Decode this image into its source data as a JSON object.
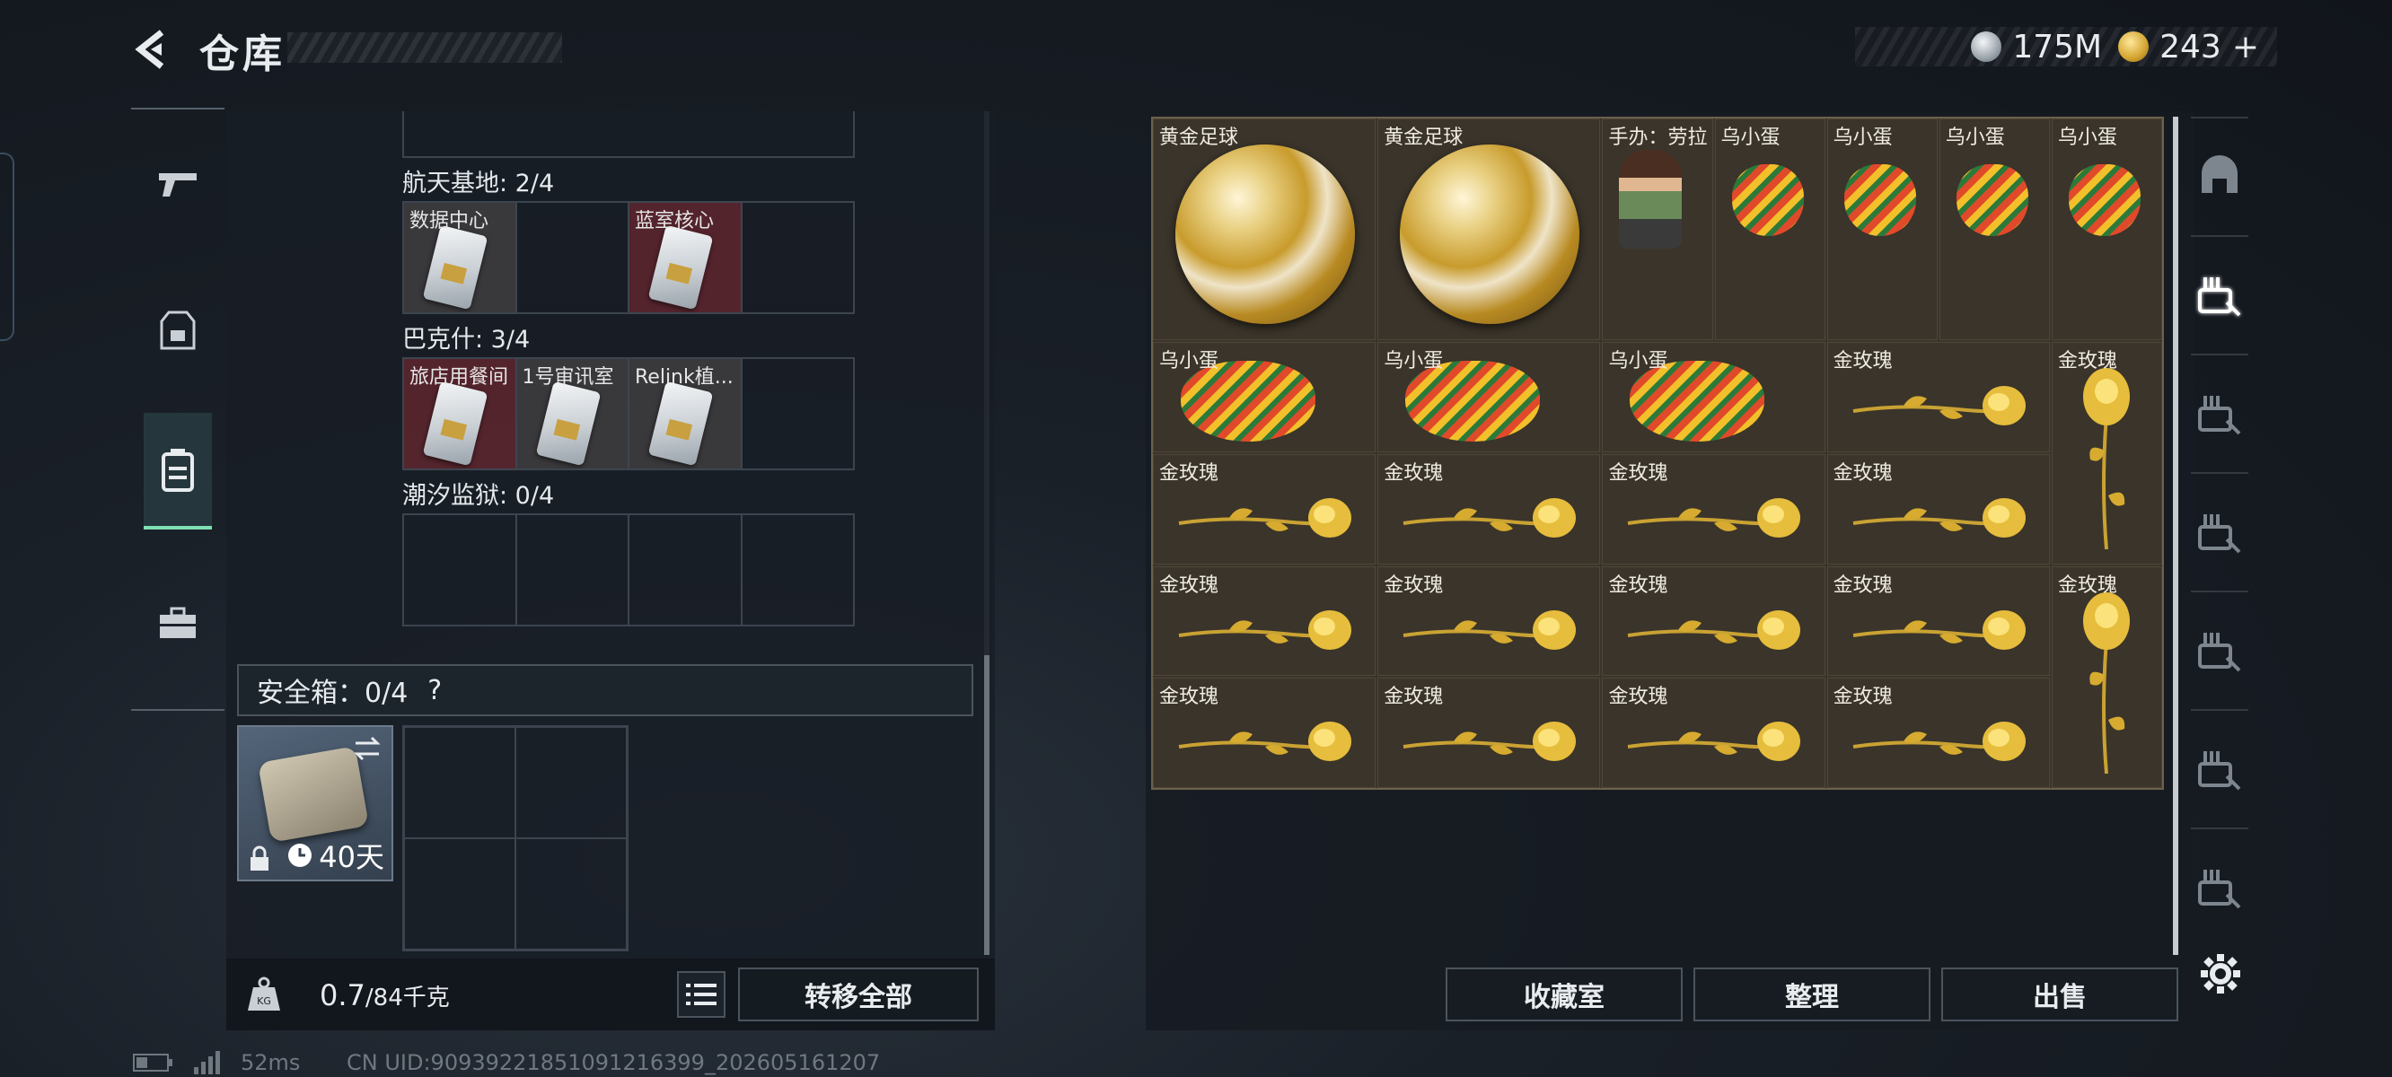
{
  "header": {
    "title": "仓库",
    "currency": [
      {
        "icon": "silver-coin-icon",
        "value": "175M"
      },
      {
        "icon": "gold-coin-icon",
        "value": "243"
      }
    ],
    "currency_add": "+"
  },
  "nav": [
    {
      "icon": "gun-icon",
      "active": false
    },
    {
      "icon": "vest-icon",
      "active": false
    },
    {
      "icon": "backpack-icon",
      "active": true
    },
    {
      "icon": "case-icon",
      "active": false
    }
  ],
  "keycard_sections": [
    {
      "label": "航天基地: 2/4",
      "slots": [
        {
          "name": "数据中心",
          "rarity": "gray",
          "filled": true
        },
        {
          "name": "",
          "filled": false
        },
        {
          "name": "蓝室核心",
          "rarity": "red",
          "filled": true
        },
        {
          "name": "",
          "filled": false
        }
      ]
    },
    {
      "label": "巴克什: 3/4",
      "slots": [
        {
          "name": "旅店用餐间",
          "rarity": "red",
          "filled": true
        },
        {
          "name": "1号审讯室",
          "rarity": "gray",
          "filled": true
        },
        {
          "name": "Relink植...",
          "rarity": "gray",
          "filled": true
        },
        {
          "name": "",
          "filled": false
        }
      ]
    },
    {
      "label": "潮汐监狱: 0/4",
      "slots": [
        {
          "name": "",
          "filled": false
        },
        {
          "name": "",
          "filled": false
        },
        {
          "name": "",
          "filled": false
        },
        {
          "name": "",
          "filled": false
        }
      ]
    }
  ],
  "safe_box": {
    "label": "安全箱：0/4",
    "help": "?",
    "days": "40天"
  },
  "weight": {
    "current": "0.7",
    "max": "/84千克"
  },
  "buttons": {
    "transfer_all": "转移全部",
    "collection": "收藏室",
    "sort": "整理",
    "sell": "出售"
  },
  "status": {
    "ping": "52ms",
    "uid": "CN UID:909392218510912163​99_202605161207"
  },
  "inventory": [
    {
      "name": "黄金足球",
      "type": "ball",
      "col": 1,
      "row": 1,
      "w": 2,
      "h": 2
    },
    {
      "name": "黄金足球",
      "type": "ball",
      "col": 3,
      "row": 1,
      "w": 2,
      "h": 2
    },
    {
      "name": "手办：劳拉",
      "type": "figure",
      "col": 5,
      "row": 1,
      "w": 1,
      "h": 2
    },
    {
      "name": "乌小蛋",
      "type": "egg",
      "col": 6,
      "row": 1,
      "w": 1,
      "h": 2
    },
    {
      "name": "乌小蛋",
      "type": "egg",
      "col": 7,
      "row": 1,
      "w": 1,
      "h": 2
    },
    {
      "name": "乌小蛋",
      "type": "egg",
      "col": 8,
      "row": 1,
      "w": 1,
      "h": 2
    },
    {
      "name": "乌小蛋",
      "type": "egg",
      "col": 9,
      "row": 1,
      "w": 1,
      "h": 2
    },
    {
      "name": "乌小蛋",
      "type": "egg-h",
      "col": 1,
      "row": 3,
      "w": 2,
      "h": 1
    },
    {
      "name": "乌小蛋",
      "type": "egg-h",
      "col": 3,
      "row": 3,
      "w": 2,
      "h": 1
    },
    {
      "name": "乌小蛋",
      "type": "egg-h",
      "col": 5,
      "row": 3,
      "w": 2,
      "h": 1
    },
    {
      "name": "金玫瑰",
      "type": "rose-h",
      "col": 7,
      "row": 3,
      "w": 2,
      "h": 1
    },
    {
      "name": "金玫瑰",
      "type": "rose-v",
      "col": 9,
      "row": 3,
      "w": 1,
      "h": 2
    },
    {
      "name": "金玫瑰",
      "type": "rose-h",
      "col": 1,
      "row": 4,
      "w": 2,
      "h": 1
    },
    {
      "name": "金玫瑰",
      "type": "rose-h",
      "col": 3,
      "row": 4,
      "w": 2,
      "h": 1
    },
    {
      "name": "金玫瑰",
      "type": "rose-h",
      "col": 5,
      "row": 4,
      "w": 2,
      "h": 1
    },
    {
      "name": "金玫瑰",
      "type": "rose-h",
      "col": 7,
      "row": 4,
      "w": 2,
      "h": 1
    },
    {
      "name": "金玫瑰",
      "type": "rose-h",
      "col": 1,
      "row": 5,
      "w": 2,
      "h": 1
    },
    {
      "name": "金玫瑰",
      "type": "rose-h",
      "col": 3,
      "row": 5,
      "w": 2,
      "h": 1
    },
    {
      "name": "金玫瑰",
      "type": "rose-h",
      "col": 5,
      "row": 5,
      "w": 2,
      "h": 1
    },
    {
      "name": "金玫瑰",
      "type": "rose-h",
      "col": 7,
      "row": 5,
      "w": 2,
      "h": 1
    },
    {
      "name": "金玫瑰",
      "type": "rose-v",
      "col": 9,
      "row": 5,
      "w": 1,
      "h": 2
    },
    {
      "name": "金玫瑰",
      "type": "rose-h",
      "col": 1,
      "row": 6,
      "w": 2,
      "h": 1
    },
    {
      "name": "金玫瑰",
      "type": "rose-h",
      "col": 3,
      "row": 6,
      "w": 2,
      "h": 1
    },
    {
      "name": "金玫瑰",
      "type": "rose-h",
      "col": 5,
      "row": 6,
      "w": 2,
      "h": 1
    },
    {
      "name": "金玫瑰",
      "type": "rose-h",
      "col": 7,
      "row": 6,
      "w": 2,
      "h": 1
    }
  ],
  "categories": [
    {
      "icon": "helmet-icon",
      "active": false
    },
    {
      "icon": "tier3-keycard-icon",
      "active": true
    },
    {
      "icon": "tier5-icon",
      "active": false
    },
    {
      "icon": "tier3-item-icon",
      "active": false
    },
    {
      "icon": "tier2-medical-icon",
      "active": false
    },
    {
      "icon": "tier2-item-icon",
      "active": false
    },
    {
      "icon": "tier2-folder-icon",
      "active": false
    }
  ],
  "colors": {
    "accent": "#7fe0b4",
    "rarity_red": "#6e2830",
    "rarity_gray": "#786e64",
    "gold_cell": "#3a342a"
  }
}
